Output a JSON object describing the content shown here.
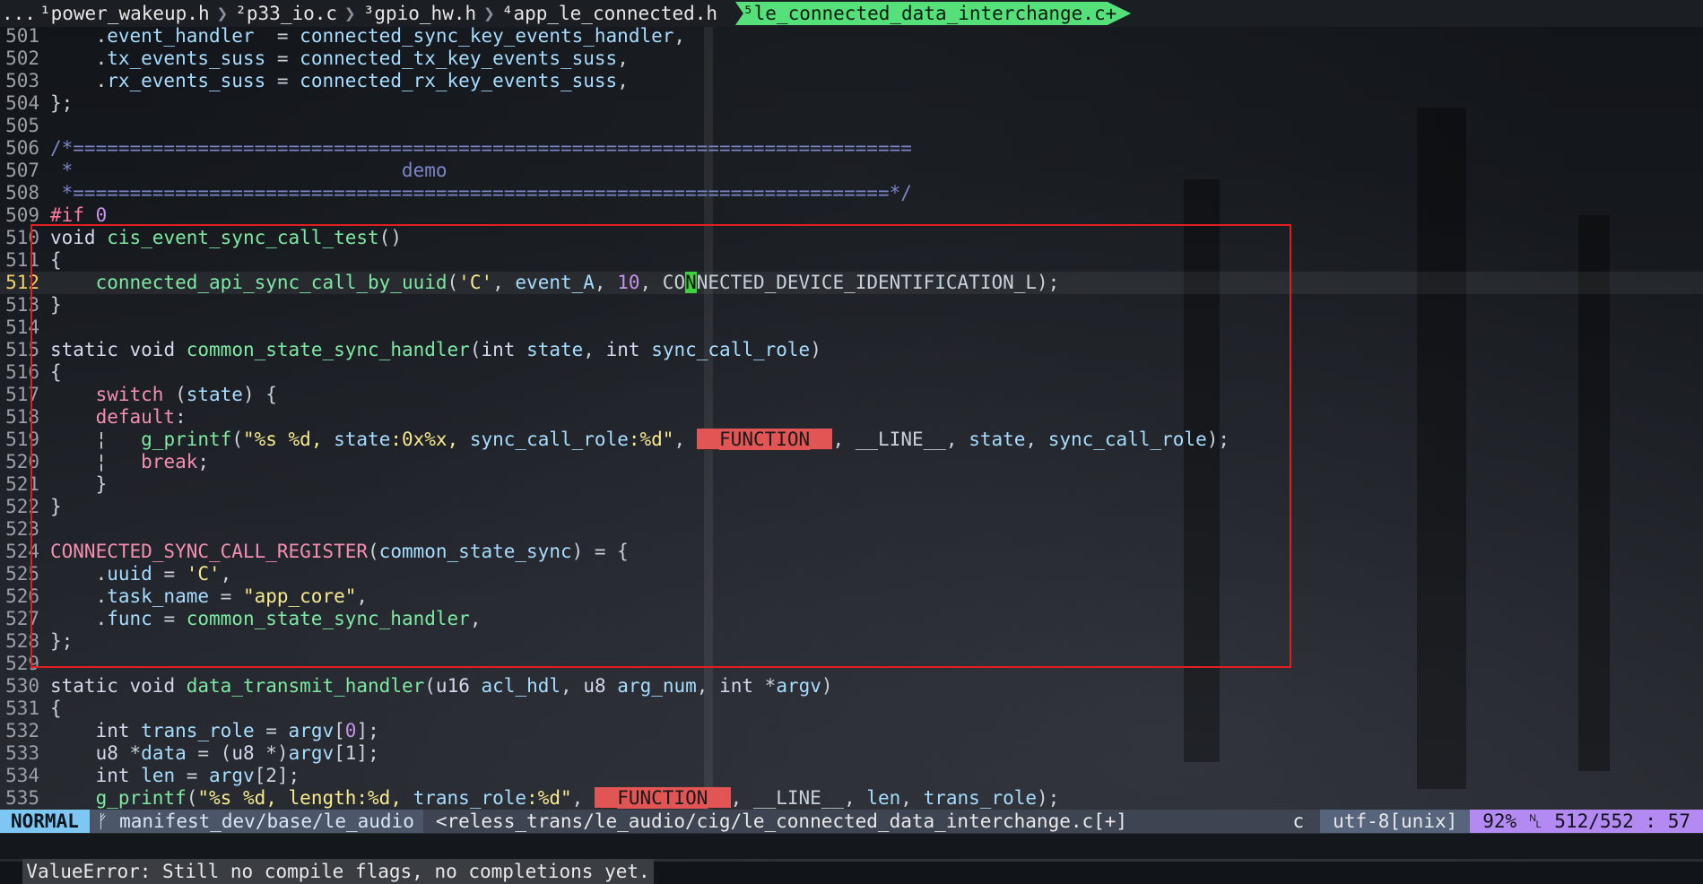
{
  "tabs": [
    {
      "label": "..."
    },
    {
      "label": "¹power_wakeup.h"
    },
    {
      "label": "²p33_io.c"
    },
    {
      "label": "³gpio_hw.h"
    },
    {
      "label": "⁴app_le_connected.h"
    },
    {
      "label": "⁵le_connected_data_interchange.c+"
    }
  ],
  "editor": {
    "current_line": "512",
    "lines": [
      {
        "n": "501",
        "text": "    .event_handler  = connected_sync_key_events_handler,"
      },
      {
        "n": "502",
        "text": "    .tx_events_suss = connected_tx_key_events_suss,"
      },
      {
        "n": "503",
        "text": "    .rx_events_suss = connected_rx_key_events_suss,"
      },
      {
        "n": "504",
        "text": "};"
      },
      {
        "n": "505",
        "text": ""
      },
      {
        "n": "506",
        "text": "/*=========================================================================="
      },
      {
        "n": "507",
        "text": " *                             demo"
      },
      {
        "n": "508",
        "text": " *========================================================================*/"
      },
      {
        "n": "509",
        "text": "#if 0"
      },
      {
        "n": "510",
        "text": "void cis_event_sync_call_test()"
      },
      {
        "n": "511",
        "text": "{"
      },
      {
        "n": "512",
        "text": "    connected_api_sync_call_by_uuid('C', event_A, 10, CONNECTED_DEVICE_IDENTIFICATION_L);"
      },
      {
        "n": "513",
        "text": "}"
      },
      {
        "n": "514",
        "text": ""
      },
      {
        "n": "515",
        "text": "static void common_state_sync_handler(int state, int sync_call_role)"
      },
      {
        "n": "516",
        "text": "{"
      },
      {
        "n": "517",
        "text": "    switch (state) {"
      },
      {
        "n": "518",
        "text": "    default:"
      },
      {
        "n": "519",
        "text": "    ¦   g_printf(\"%s %d, state:0x%x, sync_call_role:%d\", __FUNCTION__, __LINE__, state, sync_call_role);"
      },
      {
        "n": "520",
        "text": "    ¦   break;"
      },
      {
        "n": "521",
        "text": "    }"
      },
      {
        "n": "522",
        "text": "}"
      },
      {
        "n": "523",
        "text": ""
      },
      {
        "n": "524",
        "text": "CONNECTED_SYNC_CALL_REGISTER(common_state_sync) = {"
      },
      {
        "n": "525",
        "text": "    .uuid = 'C',"
      },
      {
        "n": "526",
        "text": "    .task_name = \"app_core\","
      },
      {
        "n": "527",
        "text": "    .func = common_state_sync_handler,"
      },
      {
        "n": "528",
        "text": "};"
      },
      {
        "n": "529",
        "text": ""
      },
      {
        "n": "530",
        "text": "static void data_transmit_handler(u16 acl_hdl, u8 arg_num, int *argv)"
      },
      {
        "n": "531",
        "text": "{"
      },
      {
        "n": "532",
        "text": "    int trans_role = argv[0];"
      },
      {
        "n": "533",
        "text": "    u8 *data = (u8 *)argv[1];"
      },
      {
        "n": "534",
        "text": "    int len = argv[2];"
      },
      {
        "n": "535",
        "text": "    g_printf(\"%s %d, length:%d, trans_role:%d\", __FUNCTION__, __LINE__, len, trans_role);"
      }
    ]
  },
  "statusline": {
    "mode": "NORMAL",
    "branch_icon": "git-branch-icon",
    "branch": " manifest_dev/base/le_audio",
    "file": "<reless_trans/le_audio/cig/le_connected_data_interchange.c[+]",
    "filetype": "c",
    "encoding": "utf-8[unix]",
    "percent": "92%",
    "position": "512/552 : 57"
  },
  "command_line": {
    "message": "ValueError: Still no compile flags, no completions yet."
  },
  "colors": {
    "mode_bg": "#7ec7f2",
    "active_tab_bg": "#56e07a",
    "position_bg": "#b38af1",
    "selection_border": "#e02020"
  }
}
